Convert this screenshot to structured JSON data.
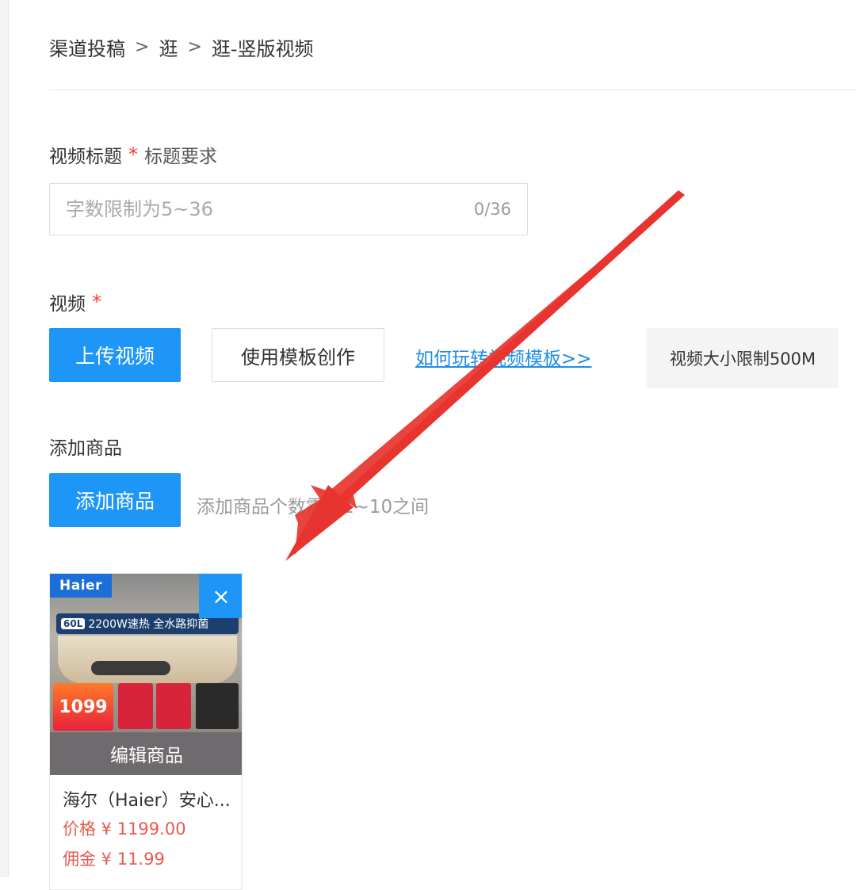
{
  "breadcrumb": {
    "items": [
      "渠道投稿",
      "逛",
      "逛-竖版视频"
    ],
    "separator": ">"
  },
  "title_field": {
    "label": "视频标题",
    "required_mark": "*",
    "requirement_link": "标题要求",
    "placeholder": "字数限制为5~36",
    "value": "",
    "counter": "0/36"
  },
  "video_section": {
    "label": "视频",
    "required_mark": "*",
    "upload_button": "上传视频",
    "template_button": "使用模板创作",
    "help_link": "如何玩转视频模板>>",
    "size_tip": "视频大小限制500M"
  },
  "product_section": {
    "label": "添加商品",
    "add_button": "添加商品",
    "helper_text": "添加商品个数需在1~10之间",
    "products": [
      {
        "brand_logo": "Haier",
        "image_band_capacity": "60L",
        "image_band_text": "2200W速热 全水路抑菌",
        "image_price": "1099",
        "edit_label": "编辑商品",
        "close_icon": "×",
        "name": "海尔（Haier）安心...",
        "price": "价格 ¥ 1199.00",
        "commission": "佣金 ¥ 11.99"
      }
    ]
  },
  "colors": {
    "primary": "#1e96f7",
    "required": "#f04134",
    "price": "#e85a4f",
    "annotation_arrow": "#e8342e"
  }
}
